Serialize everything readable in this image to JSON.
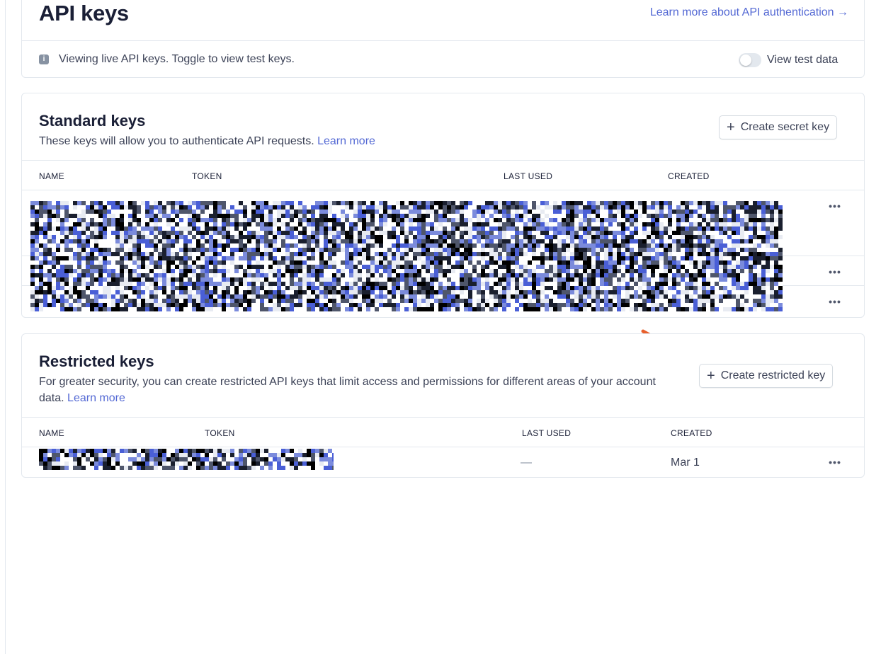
{
  "header": {
    "title": "API keys",
    "learn_more_auth": "Learn more about API authentication →",
    "info_text": "Viewing live API keys. Toggle to view test keys.",
    "test_toggle_label": "View test data",
    "test_toggle_on": false
  },
  "standard_keys": {
    "title": "Standard keys",
    "description": "These keys will allow you to authenticate API requests.",
    "learn_more": "Learn more",
    "create_button": "Create secret key",
    "columns": [
      "NAME",
      "TOKEN",
      "LAST USED",
      "CREATED"
    ],
    "row_count": 3
  },
  "restricted_keys": {
    "title": "Restricted keys",
    "description": "For greater security, you can create restricted API keys that limit access and permissions for different areas of your account data.",
    "learn_more": "Learn more",
    "create_button": "Create restricted key",
    "columns": [
      "NAME",
      "TOKEN",
      "LAST USED",
      "CREATED"
    ],
    "rows": [
      {
        "last_used": "—",
        "created": "Mar 1"
      }
    ]
  },
  "icons": {
    "info": "info-icon",
    "plus": "plus-icon",
    "more": "more-horizontal-icon",
    "arrow": "annotation-arrow-icon"
  },
  "colors": {
    "link": "#5469d4",
    "annotation_arrow": "#e8602c",
    "redaction_blue": "#4a5fd6",
    "redaction_dark": "#1a1f2e"
  }
}
